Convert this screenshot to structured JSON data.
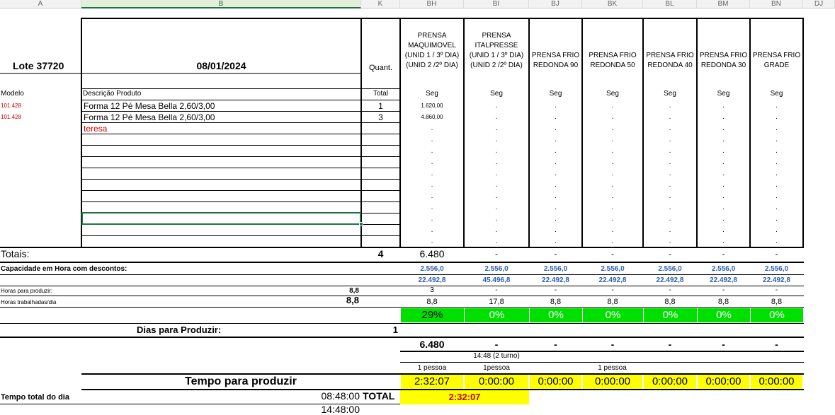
{
  "columns": [
    "A",
    "B",
    "K",
    "BH",
    "BI",
    "BJ",
    "BK",
    "BL",
    "BM",
    "BN",
    "DJ"
  ],
  "header": {
    "lote": "Lote 37720",
    "date": "08/01/2024",
    "quant_label": "Quant.",
    "modelo_label": "Modelo",
    "descricao_label": "Descrição Produto",
    "total_label": "Total"
  },
  "presses": [
    {
      "lines": [
        "PRENSA",
        "MAQUIMOVEL",
        "(UNID 1 / 3º DIA)",
        "(UNID 2 /2º DIA)"
      ],
      "unit": "Seg"
    },
    {
      "lines": [
        "PRENSA",
        "ITALPRESSE",
        "(UNID 1 / 3º DIA)",
        "(UNID 2 /2º DIA)"
      ],
      "unit": "Seg"
    },
    {
      "lines": [
        "PRENSA FRIO",
        "REDONDA 90"
      ],
      "unit": "Seg"
    },
    {
      "lines": [
        "PRENSA FRIO",
        "REDONDA 50"
      ],
      "unit": "Seg"
    },
    {
      "lines": [
        "PRENSA FRIO",
        "REDONDA 40"
      ],
      "unit": "Seg"
    },
    {
      "lines": [
        "PRENSA FRIO",
        "REDONDA 30"
      ],
      "unit": "Seg"
    },
    {
      "lines": [
        "PRENSA FRIO",
        "GRADE"
      ],
      "unit": "Seg"
    }
  ],
  "items": [
    {
      "modelo": "101.428",
      "descricao": "Forma 12 Pé Mesa Bella 2,60/3,00",
      "quant": "1",
      "bh": "1.620,00"
    },
    {
      "modelo": "101.428",
      "descricao": "Forma 12 Pé Mesa Bella 2,60/3,00",
      "quant": "3",
      "bh": "4.860,00"
    },
    {
      "modelo": "",
      "descricao": "teresa",
      "quant": "",
      "bh": ""
    }
  ],
  "dash": "-",
  "dot": ".",
  "totais": {
    "label": "Totais:",
    "quant": "4",
    "values": [
      "6.480",
      "-",
      "-",
      "-",
      "-",
      "-",
      "-"
    ]
  },
  "capacidade": {
    "label": "Capacidade em Hora com descontos:",
    "row1": [
      "2.556,0",
      "2.556,0",
      "2.556,0",
      "2.556,0",
      "2.556,0",
      "2.556,0",
      "2.556,0"
    ],
    "row2": [
      "22.492,8",
      "45.496,8",
      "22.492,8",
      "22.492,8",
      "22.492,8",
      "22.492,8",
      "22.492,8"
    ]
  },
  "horas_produzir": {
    "label": "Horas para produzir:",
    "value": "8,8",
    "values": [
      "3",
      "-",
      "-",
      "-",
      "-",
      "-",
      "-"
    ]
  },
  "horas_trabalhadas": {
    "label": "Horas trabalhadas/dia",
    "value": "8,8",
    "values": [
      "8,8",
      "17,8",
      "8,8",
      "8,8",
      "8,8",
      "8,8",
      "8,8"
    ]
  },
  "percent": [
    "29%",
    "0%",
    "0%",
    "0%",
    "0%",
    "0%",
    "0%"
  ],
  "dias": {
    "label": "Dias para Produzir:",
    "value": "1"
  },
  "totals2": [
    "6.480",
    "-",
    "-",
    "-",
    "-",
    "-",
    "-"
  ],
  "turno": "14:48 (2 turno)",
  "pessoa": [
    "1 pessoa",
    "1pessoa",
    "1 pessoa"
  ],
  "tempo": {
    "label": "Tempo para produzir",
    "values": [
      "2:32:07",
      "0:00:00",
      "0:00:00",
      "0:00:00",
      "0:00:00",
      "0:00:00",
      "0:00:00"
    ]
  },
  "tempo_total": {
    "label": "Tempo total do dia",
    "time1": "08:48:00",
    "time2": "14:48:00",
    "total_label": "TOTAL",
    "total_value": "2:32:07"
  },
  "colors": {
    "green": "#00e000",
    "yellow": "#ffff00",
    "blue": "#2f5fb3",
    "red": "#c00000"
  }
}
